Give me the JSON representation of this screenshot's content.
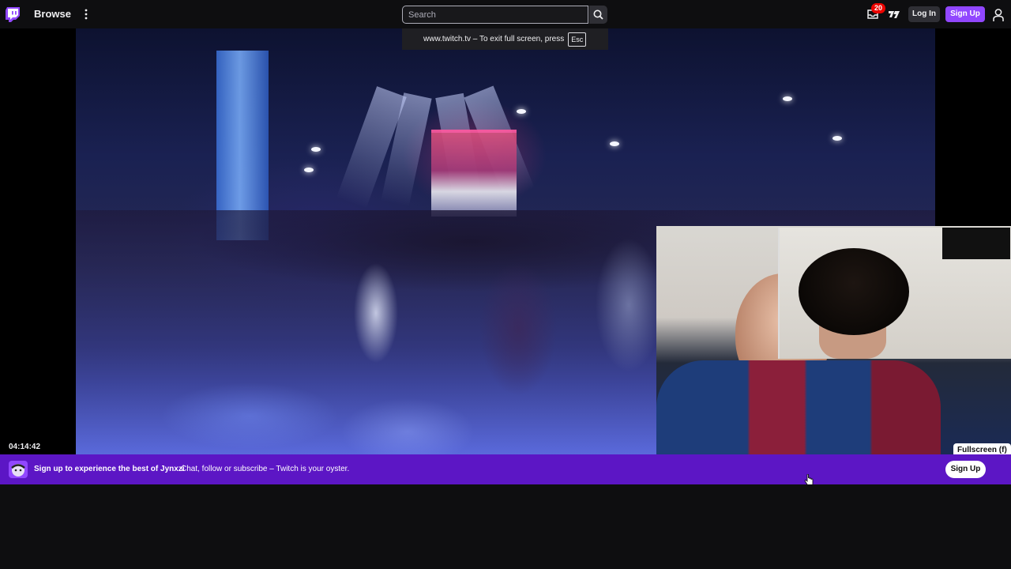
{
  "nav": {
    "browse_label": "Browse",
    "search_placeholder": "Search",
    "notification_count": "20",
    "login_label": "Log In",
    "signup_label": "Sign Up"
  },
  "fullscreen_toast": {
    "message": "www.twitch.tv – To exit full screen, press",
    "key": "Esc"
  },
  "player": {
    "timestamp": "04:14:42",
    "fullscreen_tooltip": "Fullscreen (f)"
  },
  "banner": {
    "title": "Sign up to experience the best of Jynxzi",
    "subtitle": "Chat, follow or subscribe – Twitch is your oyster.",
    "button_label": "Sign Up"
  },
  "colors": {
    "brand_purple": "#9147ff",
    "banner_purple": "#5c16c5",
    "background": "#0e0e10",
    "badge_red": "#eb0400"
  },
  "icons": [
    "twitch-logo-icon",
    "more-vertical-icon",
    "search-icon",
    "inbox-icon",
    "prime-crown-icon",
    "user-icon",
    "streamer-avatar",
    "mouse-cursor-icon"
  ]
}
